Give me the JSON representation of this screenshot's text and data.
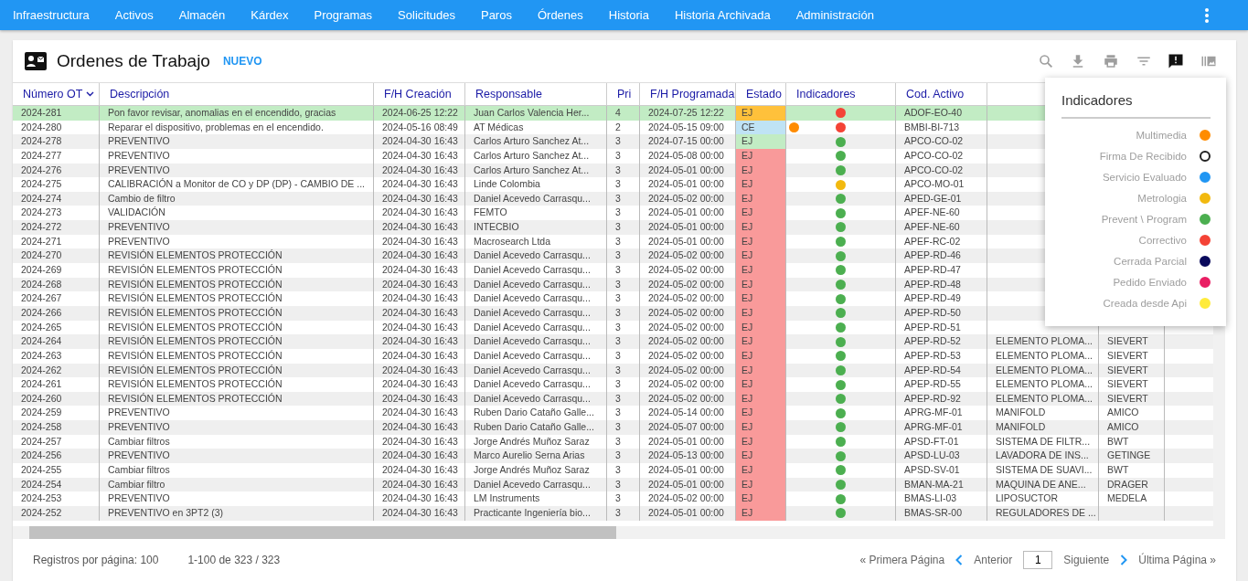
{
  "nav": {
    "items": [
      "Infraestructura",
      "Activos",
      "Almacén",
      "Kárdex",
      "Programas",
      "Solicitudes",
      "Paros",
      "Órdenes",
      "Historia",
      "Historia Archivada",
      "Administración"
    ]
  },
  "header": {
    "title": "Ordenes de Trabajo",
    "new_label": "NUEVO"
  },
  "table": {
    "columns": [
      {
        "label": "Número OT",
        "sorted": true
      },
      {
        "label": "Descripción",
        "sorted": false
      },
      {
        "label": "F/H Creación",
        "sorted": false
      },
      {
        "label": "Responsable",
        "sorted": false
      },
      {
        "label": "Pri",
        "sorted": false
      },
      {
        "label": "F/H Programada",
        "sorted": false
      },
      {
        "label": "Estado",
        "sorted": false
      },
      {
        "label": "Indicadores",
        "sorted": false
      },
      {
        "label": "Cod. Activo",
        "sorted": false
      }
    ],
    "rows": [
      {
        "selected": true,
        "numero": "2024-281",
        "descripcion": "Pon favor revisar, anomalias en el encendido, gracias",
        "creacion": "2024-06-25 12:22",
        "responsable": "Juan Carlos Valencia Her...",
        "pri": "4",
        "programada": "2024-07-25 12:22",
        "estado": {
          "label": "EJ",
          "color": "#ffc13b"
        },
        "indicadores": [
          {
            "color": "#f44336"
          }
        ],
        "cod_activo": "ADOF-EO-40"
      },
      {
        "selected": false,
        "numero": "2024-280",
        "descripcion": "Reparar el dispositivo, problemas en el encendido.",
        "creacion": "2024-05-16 08:49",
        "responsable": "AT Médicas",
        "pri": "2",
        "programada": "2024-05-15 09:00",
        "estado": {
          "label": "CE",
          "color": "#bfe3f5"
        },
        "indicadores": [
          {
            "color": "#ff8c00"
          },
          {
            "color": "#f44336"
          }
        ],
        "cod_activo": "BMBI-BI-713"
      },
      {
        "selected": false,
        "numero": "2024-278",
        "descripcion": "PREVENTIVO",
        "creacion": "2024-04-30 16:43",
        "responsable": "Carlos Arturo Sanchez At...",
        "pri": "3",
        "programada": "2024-07-15 00:00",
        "estado": {
          "label": "EJ",
          "color": "#c2ecc4"
        },
        "indicadores": [
          {
            "color": "#4caf50"
          }
        ],
        "cod_activo": "APCO-CO-02"
      },
      {
        "selected": false,
        "numero": "2024-277",
        "descripcion": "PREVENTIVO",
        "creacion": "2024-04-30 16:43",
        "responsable": "Carlos Arturo Sanchez At...",
        "pri": "3",
        "programada": "2024-05-08 00:00",
        "estado": {
          "label": "EJ",
          "color": "#f99a9a"
        },
        "indicadores": [
          {
            "color": "#4caf50"
          }
        ],
        "cod_activo": "APCO-CO-02"
      },
      {
        "selected": false,
        "numero": "2024-276",
        "descripcion": "PREVENTIVO",
        "creacion": "2024-04-30 16:43",
        "responsable": "Carlos Arturo Sanchez At...",
        "pri": "3",
        "programada": "2024-05-01 00:00",
        "estado": {
          "label": "EJ",
          "color": "#f99a9a"
        },
        "indicadores": [
          {
            "color": "#4caf50"
          }
        ],
        "cod_activo": "APCO-CO-02"
      },
      {
        "selected": false,
        "numero": "2024-275",
        "descripcion": "CALIBRACIÓN a Monitor de CO y DP (DP) - CAMBIO DE ...",
        "creacion": "2024-04-30 16:43",
        "responsable": "Linde Colombia",
        "pri": "3",
        "programada": "2024-05-01 00:00",
        "estado": {
          "label": "EJ",
          "color": "#f99a9a"
        },
        "indicadores": [
          {
            "color": "#f2b90f"
          }
        ],
        "cod_activo": "APCO-MO-01"
      },
      {
        "selected": false,
        "numero": "2024-274",
        "descripcion": "Cambio de filtro",
        "creacion": "2024-04-30 16:43",
        "responsable": "Daniel Acevedo Carrasqu...",
        "pri": "3",
        "programada": "2024-05-02 00:00",
        "estado": {
          "label": "EJ",
          "color": "#f99a9a"
        },
        "indicadores": [
          {
            "color": "#4caf50"
          }
        ],
        "cod_activo": "APED-GE-01"
      },
      {
        "selected": false,
        "numero": "2024-273",
        "descripcion": "VALIDACIÓN",
        "creacion": "2024-04-30 16:43",
        "responsable": "FEMTO",
        "pri": "3",
        "programada": "2024-05-01 00:00",
        "estado": {
          "label": "EJ",
          "color": "#f99a9a"
        },
        "indicadores": [
          {
            "color": "#4caf50"
          }
        ],
        "cod_activo": "APEF-NE-60"
      },
      {
        "selected": false,
        "numero": "2024-272",
        "descripcion": "PREVENTIVO",
        "creacion": "2024-04-30 16:43",
        "responsable": "INTECBIO",
        "pri": "3",
        "programada": "2024-05-01 00:00",
        "estado": {
          "label": "EJ",
          "color": "#f99a9a"
        },
        "indicadores": [
          {
            "color": "#4caf50"
          }
        ],
        "cod_activo": "APEF-NE-60"
      },
      {
        "selected": false,
        "numero": "2024-271",
        "descripcion": "PREVENTIVO",
        "creacion": "2024-04-30 16:43",
        "responsable": "Macrosearch Ltda",
        "pri": "3",
        "programada": "2024-05-01 00:00",
        "estado": {
          "label": "EJ",
          "color": "#f99a9a"
        },
        "indicadores": [
          {
            "color": "#4caf50"
          }
        ],
        "cod_activo": "APEF-RC-02"
      },
      {
        "selected": false,
        "numero": "2024-270",
        "descripcion": "REVISIÓN ELEMENTOS PROTECCIÓN",
        "creacion": "2024-04-30 16:43",
        "responsable": "Daniel Acevedo Carrasqu...",
        "pri": "3",
        "programada": "2024-05-02 00:00",
        "estado": {
          "label": "EJ",
          "color": "#f99a9a"
        },
        "indicadores": [
          {
            "color": "#4caf50"
          }
        ],
        "cod_activo": "APEP-RD-46"
      },
      {
        "selected": false,
        "numero": "2024-269",
        "descripcion": "REVISIÓN ELEMENTOS PROTECCIÓN",
        "creacion": "2024-04-30 16:43",
        "responsable": "Daniel Acevedo Carrasqu...",
        "pri": "3",
        "programada": "2024-05-02 00:00",
        "estado": {
          "label": "EJ",
          "color": "#f99a9a"
        },
        "indicadores": [
          {
            "color": "#4caf50"
          }
        ],
        "cod_activo": "APEP-RD-47"
      },
      {
        "selected": false,
        "numero": "2024-268",
        "descripcion": "REVISIÓN ELEMENTOS PROTECCIÓN",
        "creacion": "2024-04-30 16:43",
        "responsable": "Daniel Acevedo Carrasqu...",
        "pri": "3",
        "programada": "2024-05-02 00:00",
        "estado": {
          "label": "EJ",
          "color": "#f99a9a"
        },
        "indicadores": [
          {
            "color": "#4caf50"
          }
        ],
        "cod_activo": "APEP-RD-48"
      },
      {
        "selected": false,
        "numero": "2024-267",
        "descripcion": "REVISIÓN ELEMENTOS PROTECCIÓN",
        "creacion": "2024-04-30 16:43",
        "responsable": "Daniel Acevedo Carrasqu...",
        "pri": "3",
        "programada": "2024-05-02 00:00",
        "estado": {
          "label": "EJ",
          "color": "#f99a9a"
        },
        "indicadores": [
          {
            "color": "#4caf50"
          }
        ],
        "cod_activo": "APEP-RD-49"
      },
      {
        "selected": false,
        "numero": "2024-266",
        "descripcion": "REVISIÓN ELEMENTOS PROTECCIÓN",
        "creacion": "2024-04-30 16:43",
        "responsable": "Daniel Acevedo Carrasqu...",
        "pri": "3",
        "programada": "2024-05-02 00:00",
        "estado": {
          "label": "EJ",
          "color": "#f99a9a"
        },
        "indicadores": [
          {
            "color": "#4caf50"
          }
        ],
        "cod_activo": "APEP-RD-50"
      },
      {
        "selected": false,
        "numero": "2024-265",
        "descripcion": "REVISIÓN ELEMENTOS PROTECCIÓN",
        "creacion": "2024-04-30 16:43",
        "responsable": "Daniel Acevedo Carrasqu...",
        "pri": "3",
        "programada": "2024-05-02 00:00",
        "estado": {
          "label": "EJ",
          "color": "#f99a9a"
        },
        "indicadores": [
          {
            "color": "#4caf50"
          }
        ],
        "cod_activo": "APEP-RD-51"
      },
      {
        "selected": false,
        "numero": "2024-264",
        "descripcion": "REVISIÓN ELEMENTOS PROTECCIÓN",
        "creacion": "2024-04-30 16:43",
        "responsable": "Daniel Acevedo Carrasqu...",
        "pri": "3",
        "programada": "2024-05-02 00:00",
        "estado": {
          "label": "EJ",
          "color": "#f99a9a"
        },
        "indicadores": [
          {
            "color": "#4caf50"
          }
        ],
        "cod_activo": "APEP-RD-52",
        "column_10": "ELEMENTO PLOMA...",
        "column_11": "SIEVERT"
      },
      {
        "selected": false,
        "numero": "2024-263",
        "descripcion": "REVISIÓN ELEMENTOS PROTECCIÓN",
        "creacion": "2024-04-30 16:43",
        "responsable": "Daniel Acevedo Carrasqu...",
        "pri": "3",
        "programada": "2024-05-02 00:00",
        "estado": {
          "label": "EJ",
          "color": "#f99a9a"
        },
        "indicadores": [
          {
            "color": "#4caf50"
          }
        ],
        "cod_activo": "APEP-RD-53",
        "column_10": "ELEMENTO PLOMA...",
        "column_11": "SIEVERT"
      },
      {
        "selected": false,
        "numero": "2024-262",
        "descripcion": "REVISIÓN ELEMENTOS PROTECCIÓN",
        "creacion": "2024-04-30 16:43",
        "responsable": "Daniel Acevedo Carrasqu...",
        "pri": "3",
        "programada": "2024-05-02 00:00",
        "estado": {
          "label": "EJ",
          "color": "#f99a9a"
        },
        "indicadores": [
          {
            "color": "#4caf50"
          }
        ],
        "cod_activo": "APEP-RD-54",
        "column_10": "ELEMENTO PLOMA...",
        "column_11": "SIEVERT"
      },
      {
        "selected": false,
        "numero": "2024-261",
        "descripcion": "REVISIÓN ELEMENTOS PROTECCIÓN",
        "creacion": "2024-04-30 16:43",
        "responsable": "Daniel Acevedo Carrasqu...",
        "pri": "3",
        "programada": "2024-05-02 00:00",
        "estado": {
          "label": "EJ",
          "color": "#f99a9a"
        },
        "indicadores": [
          {
            "color": "#4caf50"
          }
        ],
        "cod_activo": "APEP-RD-55",
        "column_10": "ELEMENTO PLOMA...",
        "column_11": "SIEVERT"
      },
      {
        "selected": false,
        "numero": "2024-260",
        "descripcion": "REVISIÓN ELEMENTOS PROTECCIÓN",
        "creacion": "2024-04-30 16:43",
        "responsable": "Daniel Acevedo Carrasqu...",
        "pri": "3",
        "programada": "2024-05-02 00:00",
        "estado": {
          "label": "EJ",
          "color": "#f99a9a"
        },
        "indicadores": [
          {
            "color": "#4caf50"
          }
        ],
        "cod_activo": "APEP-RD-92",
        "column_10": "ELEMENTO PLOMA...",
        "column_11": "SIEVERT"
      },
      {
        "selected": false,
        "numero": "2024-259",
        "descripcion": "PREVENTIVO",
        "creacion": "2024-04-30 16:43",
        "responsable": "Ruben Dario Cataño Galle...",
        "pri": "3",
        "programada": "2024-05-14 00:00",
        "estado": {
          "label": "EJ",
          "color": "#f99a9a"
        },
        "indicadores": [
          {
            "color": "#4caf50"
          }
        ],
        "cod_activo": "APRG-MF-01",
        "column_10": "MANIFOLD",
        "column_11": "AMICO"
      },
      {
        "selected": false,
        "numero": "2024-258",
        "descripcion": "PREVENTIVO",
        "creacion": "2024-04-30 16:43",
        "responsable": "Ruben Dario Cataño Galle...",
        "pri": "3",
        "programada": "2024-05-07 00:00",
        "estado": {
          "label": "EJ",
          "color": "#f99a9a"
        },
        "indicadores": [
          {
            "color": "#4caf50"
          }
        ],
        "cod_activo": "APRG-MF-01",
        "column_10": "MANIFOLD",
        "column_11": "AMICO"
      },
      {
        "selected": false,
        "numero": "2024-257",
        "descripcion": "Cambiar filtros",
        "creacion": "2024-04-30 16:43",
        "responsable": "Jorge Andrés Muñoz Saraz",
        "pri": "3",
        "programada": "2024-05-01 00:00",
        "estado": {
          "label": "EJ",
          "color": "#f99a9a"
        },
        "indicadores": [
          {
            "color": "#4caf50"
          }
        ],
        "cod_activo": "APSD-FT-01",
        "column_10": "SISTEMA DE FILTR...",
        "column_11": "BWT"
      },
      {
        "selected": false,
        "numero": "2024-256",
        "descripcion": "PREVENTIVO",
        "creacion": "2024-04-30 16:43",
        "responsable": "Marco Aurelio Serna Arias",
        "pri": "3",
        "programada": "2024-05-13 00:00",
        "estado": {
          "label": "EJ",
          "color": "#f99a9a"
        },
        "indicadores": [
          {
            "color": "#4caf50"
          }
        ],
        "cod_activo": "APSD-LU-03",
        "column_10": "LAVADORA DE INS...",
        "column_11": "GETINGE"
      },
      {
        "selected": false,
        "numero": "2024-255",
        "descripcion": "Cambiar filtros",
        "creacion": "2024-04-30 16:43",
        "responsable": "Jorge Andrés Muñoz Saraz",
        "pri": "3",
        "programada": "2024-05-01 00:00",
        "estado": {
          "label": "EJ",
          "color": "#f99a9a"
        },
        "indicadores": [
          {
            "color": "#4caf50"
          }
        ],
        "cod_activo": "APSD-SV-01",
        "column_10": "SISTEMA DE SUAVI...",
        "column_11": "BWT"
      },
      {
        "selected": false,
        "numero": "2024-254",
        "descripcion": "Cambiar filtro",
        "creacion": "2024-04-30 16:43",
        "responsable": "Daniel Acevedo Carrasqu...",
        "pri": "3",
        "programada": "2024-05-01 00:00",
        "estado": {
          "label": "EJ",
          "color": "#f99a9a"
        },
        "indicadores": [
          {
            "color": "#4caf50"
          }
        ],
        "cod_activo": "BMAN-MA-21",
        "column_10": "MAQUINA DE ANE...",
        "column_11": "DRAGER"
      },
      {
        "selected": false,
        "numero": "2024-253",
        "descripcion": "PREVENTIVO",
        "creacion": "2024-04-30 16:43",
        "responsable": "LM Instruments",
        "pri": "3",
        "programada": "2024-05-02 00:00",
        "estado": {
          "label": "EJ",
          "color": "#f99a9a"
        },
        "indicadores": [
          {
            "color": "#4caf50"
          }
        ],
        "cod_activo": "BMAS-LI-03",
        "column_10": "LIPOSUCTOR",
        "column_11": "MEDELA"
      },
      {
        "selected": false,
        "numero": "2024-252",
        "descripcion": "PREVENTIVO en 3PT2 (3)",
        "creacion": "2024-04-30 16:43",
        "responsable": "Practicante Ingeniería bio...",
        "pri": "3",
        "programada": "2024-05-01 00:00",
        "estado": {
          "label": "EJ",
          "color": "#f99a9a"
        },
        "indicadores": [
          {
            "color": "#4caf50"
          }
        ],
        "cod_activo": "BMAS-SR-00",
        "column_10": "REGULADORES DE ..."
      }
    ]
  },
  "legend": {
    "title": "Indicadores",
    "items": [
      {
        "label": "Multimedia",
        "color": "#ff8c00",
        "kind": "filled"
      },
      {
        "label": "Firma De Recibido",
        "color": "#212121",
        "kind": "outline"
      },
      {
        "label": "Servicio Evaluado",
        "color": "#2196f3",
        "kind": "filled"
      },
      {
        "label": "Metrologia",
        "color": "#f2b90f",
        "kind": "filled"
      },
      {
        "label": "Prevent \\ Program",
        "color": "#4caf50",
        "kind": "filled"
      },
      {
        "label": "Correctivo",
        "color": "#f44336",
        "kind": "filled"
      },
      {
        "label": "Cerrada Parcial",
        "color": "#0a0a5c",
        "kind": "filled"
      },
      {
        "label": "Pedido Enviado",
        "color": "#e91e63",
        "kind": "filled"
      },
      {
        "label": "Creada desde Api",
        "color": "#ffeb3b",
        "kind": "filled"
      }
    ]
  },
  "footer": {
    "per_page": "Registros por página: 100",
    "range": "1-100 de 323 / 323",
    "first": "« Primera Página",
    "prev": "Anterior",
    "page": "1",
    "next": "Siguiente",
    "last": "Última Página »"
  }
}
